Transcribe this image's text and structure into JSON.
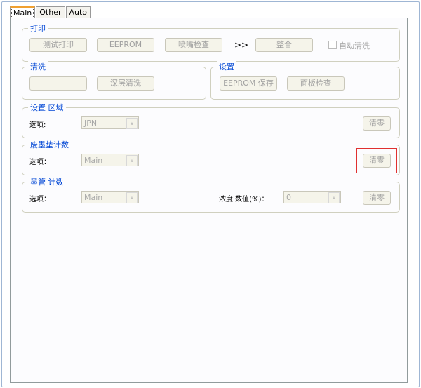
{
  "tabs": [
    "Main",
    "Other",
    "Auto"
  ],
  "print_group": {
    "title": "打印",
    "buttons": [
      "测试打印",
      "EEPROM",
      "喷嘴检查"
    ],
    "arrow": ">>",
    "merge": "整合",
    "auto_clean": {
      "label": "自动清洗",
      "checked": false
    }
  },
  "clean_group": {
    "title": "清洗",
    "buttons": [
      "",
      "深层清洗"
    ]
  },
  "settings_group": {
    "title": "设置",
    "buttons": [
      "EEPROM 保存",
      "面板检查"
    ]
  },
  "region_group": {
    "title": "设置 区域",
    "label": "选项:",
    "value": "JPN",
    "clear": "清零"
  },
  "waste_group": {
    "title": "废墨垫计数",
    "label": "选项：",
    "value": "Main",
    "clear": "清零"
  },
  "tube_group": {
    "title": "墨管 计数",
    "label": "选项：",
    "value": "Main",
    "density_label": "浓度 数值(%)：",
    "density_value": "0",
    "clear": "清零"
  }
}
